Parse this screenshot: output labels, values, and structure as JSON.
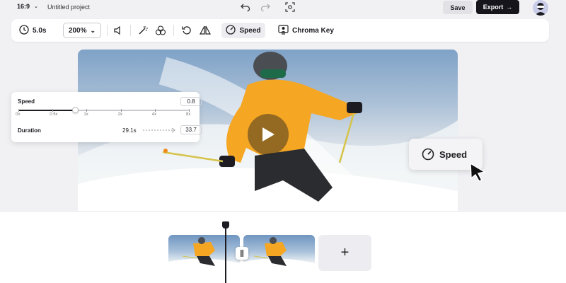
{
  "topbar": {
    "aspect_ratio": "16:9",
    "project_title": "Untitled project",
    "save_label": "Save",
    "export_label": "Export"
  },
  "toolbar": {
    "duration": "5.0s",
    "zoom": "200%",
    "speed_label": "Speed",
    "chroma_label": "Chroma Key"
  },
  "speed_panel": {
    "speed_label": "Speed",
    "speed_value": "0.8",
    "slider_fraction": 0.33,
    "ticks": [
      "0x",
      "0.5x",
      "1x",
      "2x",
      "4x",
      "8x"
    ],
    "duration_label": "Duration",
    "duration_old": "29.1s",
    "duration_new": "33.7"
  },
  "badge": {
    "label": "Speed"
  },
  "colors": {
    "accent_dark": "#15151b",
    "jacket_orange": "#f5a623"
  }
}
